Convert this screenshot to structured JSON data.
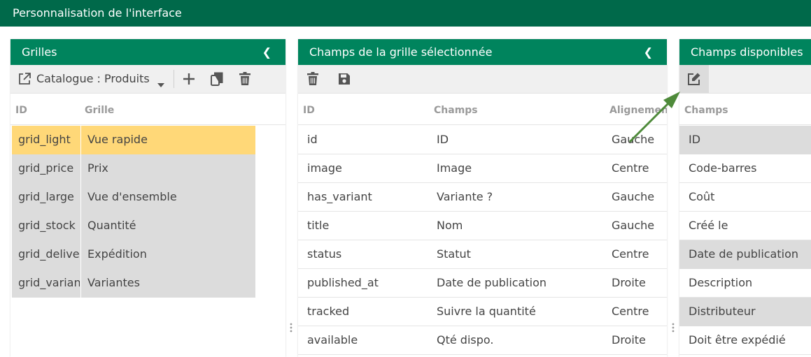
{
  "app": {
    "title": "Personnalisation de l'interface"
  },
  "colors": {
    "topbar": "#00694a",
    "panel_header": "#00845d",
    "selected_row": "#ffd878",
    "gray_row": "#dcdcdc",
    "arrow": "#4e8a3a"
  },
  "grids_panel": {
    "title": "Grilles",
    "selector_value": "Catalogue : Produits",
    "icons": [
      "open-external-icon",
      "chevron-down-icon",
      "plus-icon",
      "copy-icon",
      "trash-icon"
    ],
    "columns": {
      "id": "ID",
      "grille": "Grille"
    },
    "rows": [
      {
        "id": "grid_light",
        "name": "Vue rapide",
        "selected": true
      },
      {
        "id": "grid_price",
        "name": "Prix"
      },
      {
        "id": "grid_large",
        "name": "Vue d'ensemble"
      },
      {
        "id": "grid_stock",
        "name": "Quantité"
      },
      {
        "id": "grid_delivery",
        "name": "Expédition"
      },
      {
        "id": "grid_variants",
        "name": "Variantes"
      }
    ]
  },
  "fields_panel": {
    "title": "Champs de la grille sélectionnée",
    "icons": [
      "trash-icon",
      "save-icon"
    ],
    "columns": {
      "id": "ID",
      "champs": "Champs",
      "alignement": "Alignement"
    },
    "rows": [
      {
        "id": "id",
        "champ": "ID",
        "align": "Gauche"
      },
      {
        "id": "image",
        "champ": "Image",
        "align": "Centre"
      },
      {
        "id": "has_variant",
        "champ": "Variante ?",
        "align": "Gauche"
      },
      {
        "id": "title",
        "champ": "Nom",
        "align": "Gauche"
      },
      {
        "id": "status",
        "champ": "Statut",
        "align": "Centre"
      },
      {
        "id": "published_at",
        "champ": "Date de publication",
        "align": "Droite"
      },
      {
        "id": "tracked",
        "champ": "Suivre la quantité",
        "align": "Centre"
      },
      {
        "id": "available",
        "champ": "Qté dispo.",
        "align": "Droite"
      }
    ]
  },
  "available_panel": {
    "title": "Champs disponibles",
    "icons": [
      "edit-icon"
    ],
    "columns": {
      "champs": "Champs"
    },
    "rows": [
      {
        "label": "ID",
        "highlighted": true
      },
      {
        "label": "Code-barres"
      },
      {
        "label": "Coût"
      },
      {
        "label": "Créé le"
      },
      {
        "label": "Date de publication",
        "highlighted": true
      },
      {
        "label": "Description"
      },
      {
        "label": "Distributeur",
        "highlighted": true
      },
      {
        "label": "Doit être expédié"
      }
    ]
  }
}
